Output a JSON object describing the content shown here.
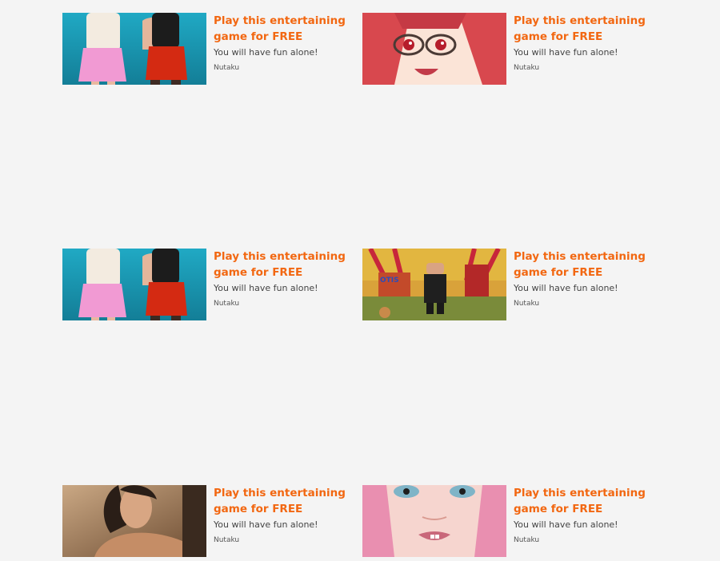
{
  "ads": [
    {
      "image": "dressed-women-thumbnail",
      "title": "Play this entertaining game for FREE",
      "description": "You will have fun alone!",
      "source": "Nutaku"
    },
    {
      "image": "anime-girl-glasses-thumbnail",
      "title": "Play this entertaining game for FREE",
      "description": "You will have fun alone!",
      "source": "Nutaku"
    },
    {
      "image": "dressed-women-thumbnail",
      "title": "Play this entertaining game for FREE",
      "description": "You will have fun alone!",
      "source": "Nutaku"
    },
    {
      "image": "game-scene-thumbnail",
      "title": "Play this entertaining game for FREE",
      "description": "You will have fun alone!",
      "source": "Nutaku",
      "image_text": "OTIS"
    },
    {
      "image": "woman-portrait-thumbnail",
      "title": "Play this entertaining game for FREE",
      "description": "You will have fun alone!",
      "source": "Nutaku"
    },
    {
      "image": "pink-hair-girl-thumbnail",
      "title": "Play this entertaining game for FREE",
      "description": "You will have fun alone!",
      "source": "Nutaku"
    }
  ],
  "colors": {
    "background": "#f4f4f4",
    "title": "#f26711",
    "description": "#444444",
    "source": "#555555"
  }
}
